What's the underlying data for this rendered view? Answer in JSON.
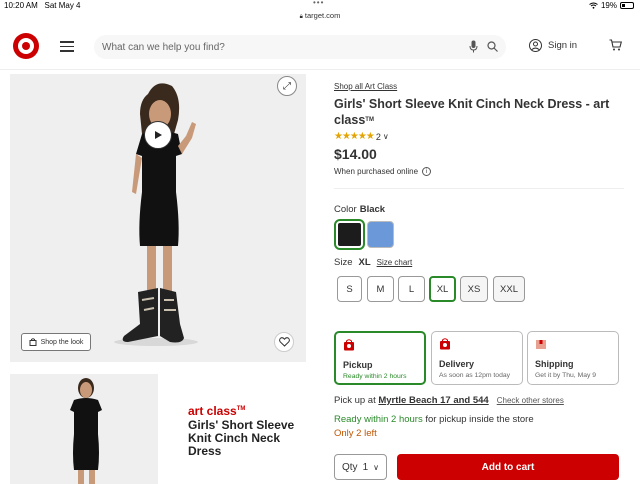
{
  "status_bar": {
    "time": "10:20 AM",
    "date": "Sat May 4",
    "battery": "19%"
  },
  "browser": {
    "url": "target.com"
  },
  "header": {
    "search_placeholder": "What can we help you find?",
    "signin_label": "Sign in",
    "brand_color": "#cc0000"
  },
  "gallery": {
    "shop_the_look_label": "Shop the look",
    "promo_brand": "art class",
    "promo_tm": "TM",
    "promo_text": "Girls' Short Sleeve Knit Cinch Neck Dress"
  },
  "product": {
    "breadcrumb": "Shop all Art Class",
    "title": "Girls' Short Sleeve Knit Cinch Neck Dress - art class",
    "title_tm": "TM",
    "stars": "★★★★★",
    "rating_count": "2",
    "rating_value": 5,
    "price": "$14.00",
    "purchase_note": "When purchased online",
    "color_label": "Color",
    "color_selected": "Black",
    "colors": [
      {
        "name": "Black",
        "hex": "#1c1c1c"
      },
      {
        "name": "Blue",
        "hex": "#6b98d8"
      }
    ],
    "size_label": "Size",
    "size_selected": "XL",
    "size_chart_label": "Size chart",
    "sizes": [
      "S",
      "M",
      "L",
      "XL",
      "XS",
      "XXL"
    ]
  },
  "fulfillment": [
    {
      "title": "Pickup",
      "subtitle": "Ready within 2 hours"
    },
    {
      "title": "Delivery",
      "subtitle": "As soon as 12pm today"
    },
    {
      "title": "Shipping",
      "subtitle": "Get it by Thu, May 9"
    }
  ],
  "pickup_info": {
    "prefix": "Pick up at",
    "store": "Myrtle Beach 17 and 544",
    "other_stores": "Check other stores",
    "ready_green": "Ready within 2 hours",
    "ready_rest": " for pickup inside the store",
    "stock": "Only 2 left"
  },
  "cart": {
    "qty_label": "Qty",
    "qty_value": "1",
    "add_label": "Add to cart"
  }
}
